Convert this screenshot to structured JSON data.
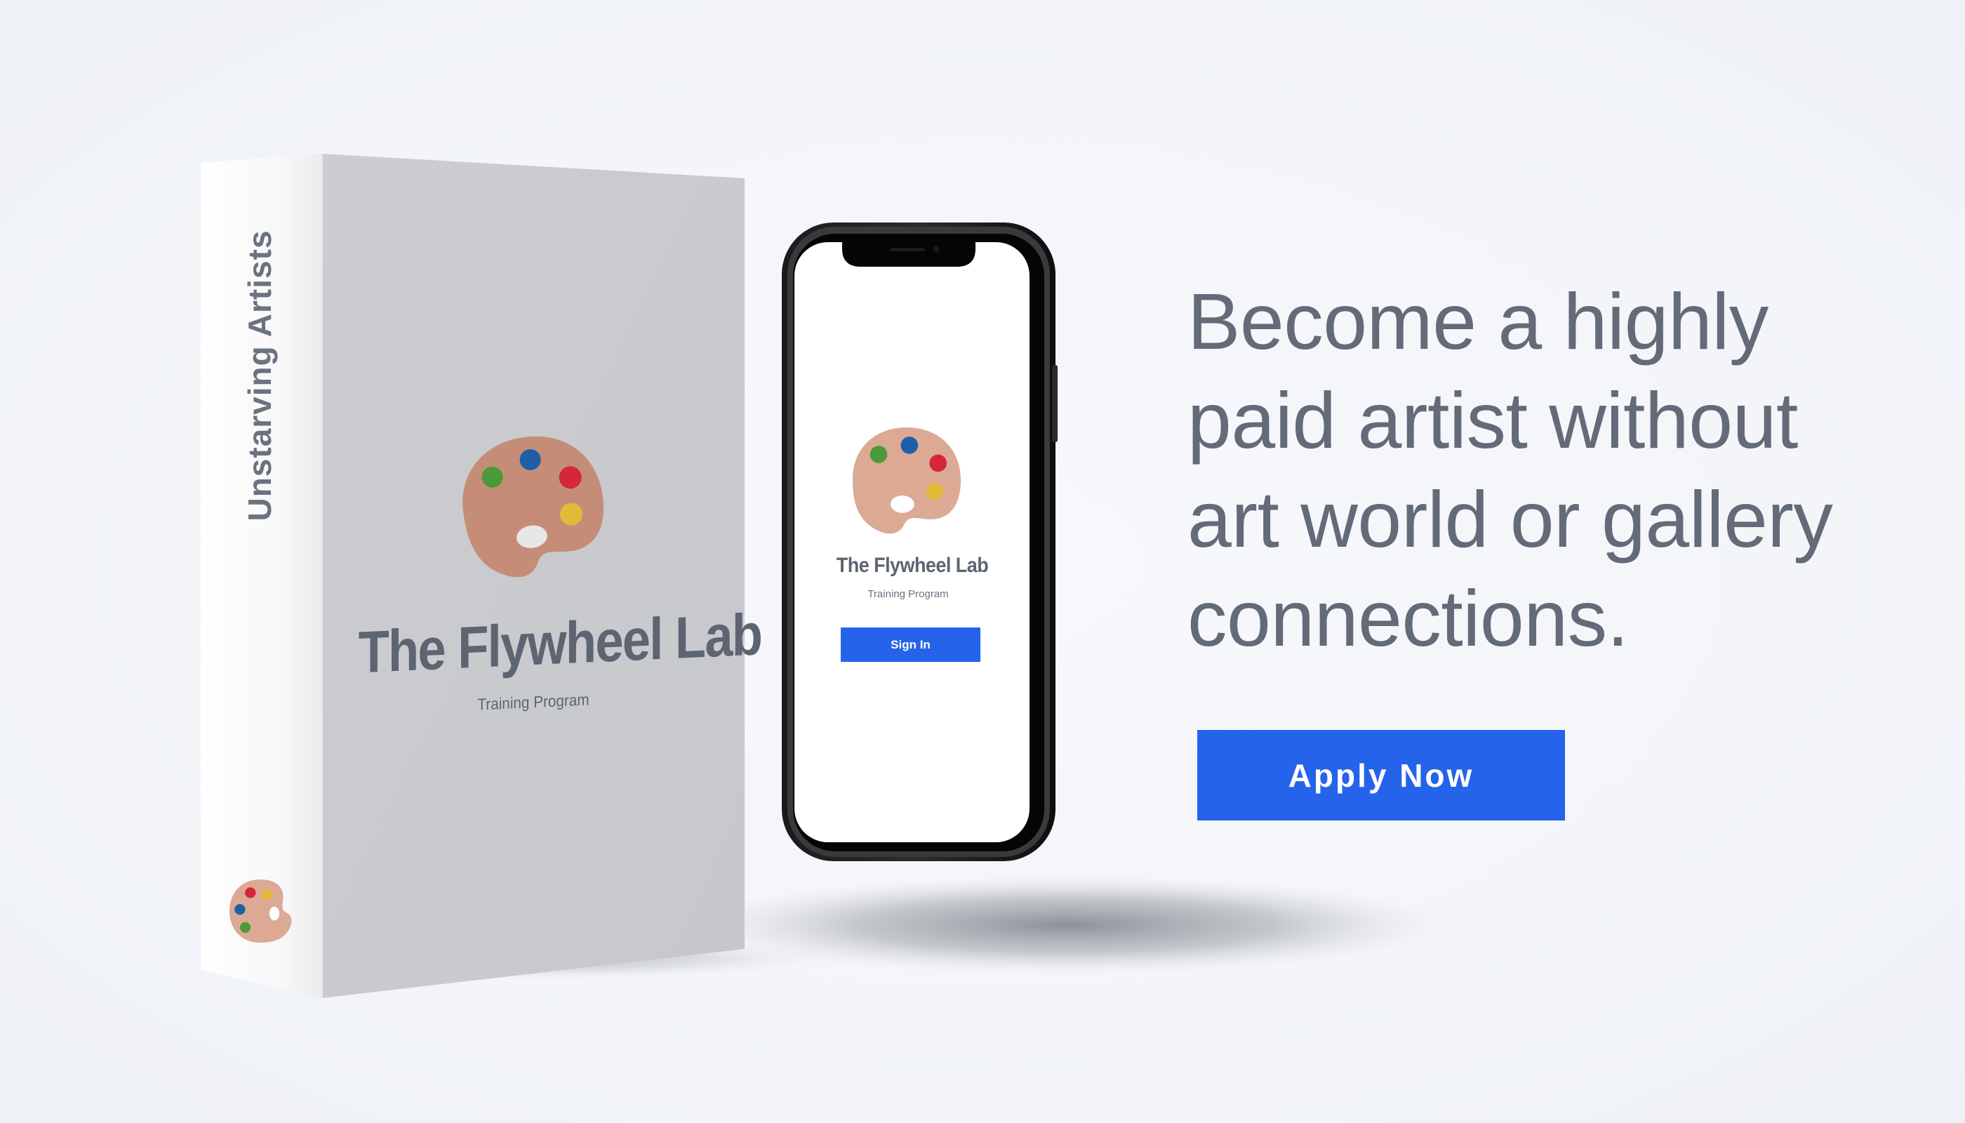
{
  "box": {
    "title": "The Flywheel Lab",
    "subtitle": "Training Program",
    "spine_text": "Unstarving Artists"
  },
  "phone": {
    "title": "The Flywheel Lab",
    "subtitle": "Training Program",
    "signin_label": "Sign In"
  },
  "hero": {
    "headline": "Become a highly paid artist without art world or gallery connections.",
    "cta_label": "Apply Now"
  },
  "icons": {
    "box_front": "palette-icon",
    "box_spine": "palette-icon",
    "phone_screen": "palette-icon"
  },
  "colors": {
    "accent": "#2563eb",
    "text_gray": "#646b78",
    "palette_body": "#c58d77",
    "paint_green": "#4a9a3c",
    "paint_blue": "#1f5fa8",
    "paint_red": "#d6263a",
    "paint_yellow": "#e3b93a",
    "box_face": "#c9cbcf",
    "box_side": "#fbfbfc"
  }
}
